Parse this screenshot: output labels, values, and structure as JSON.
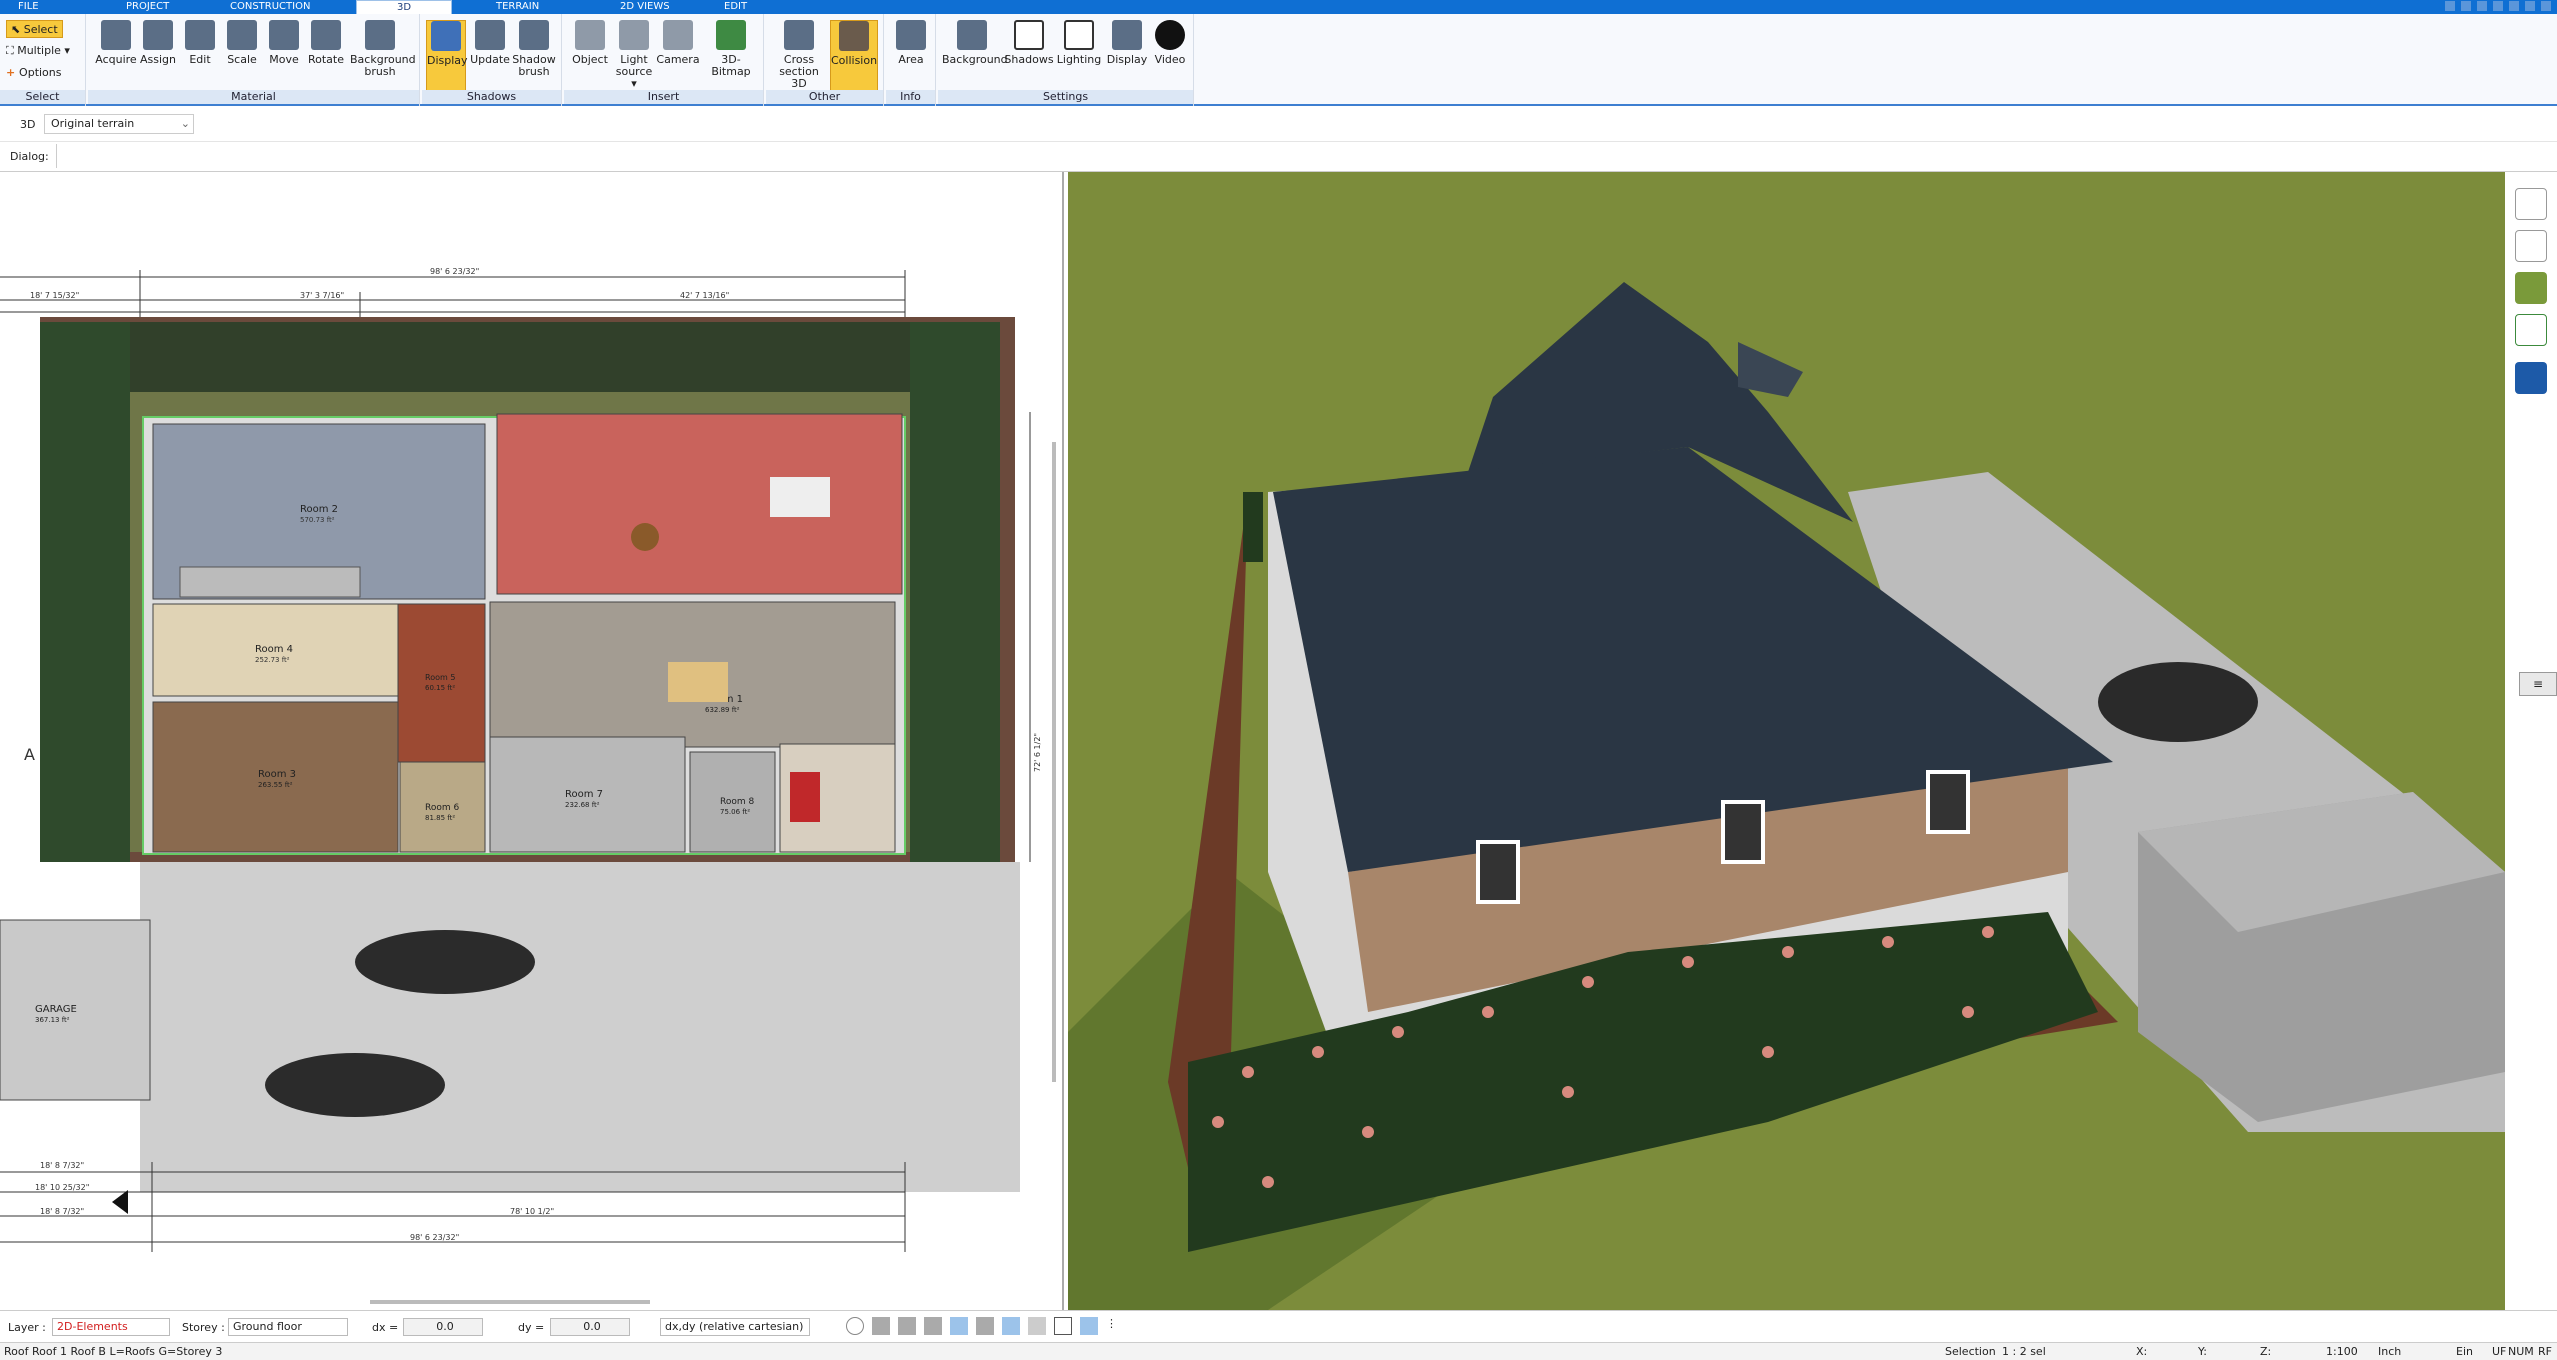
{
  "menu": {
    "tabs": [
      "FILE",
      "PROJECT",
      "CONSTRUCTION",
      "3D",
      "TERRAIN",
      "2D VIEWS",
      "EDIT"
    ]
  },
  "ribbon": {
    "select_group": {
      "select": "Select",
      "multiple": "Multiple",
      "options": "Options",
      "label": "Select"
    },
    "material": {
      "acquire": "Acquire",
      "assign": "Assign",
      "edit": "Edit",
      "scale": "Scale",
      "move": "Move",
      "rotate": "Rotate",
      "background_brush_1": "Background",
      "background_brush_2": "brush",
      "label": "Material"
    },
    "shadows": {
      "display": "Display",
      "update": "Update",
      "shadow_brush_1": "Shadow",
      "shadow_brush_2": "brush",
      "label": "Shadows"
    },
    "insert": {
      "object": "Object",
      "light_source_1": "Light",
      "light_source_2": "source",
      "camera": "Camera",
      "bitmap": "3D-Bitmap",
      "label": "Insert"
    },
    "other": {
      "cross_section_1": "Cross",
      "cross_section_2": "section 3D",
      "collision": "Collision",
      "label": "Other"
    },
    "info": {
      "area": "Area",
      "label": "Info"
    },
    "settings": {
      "background": "Background",
      "shadows": "Shadows",
      "lighting": "Lighting",
      "display": "Display",
      "video": "Video",
      "label": "Settings"
    }
  },
  "selection_row": {
    "mode": "3D",
    "terrain": "Original terrain"
  },
  "dialog_row": {
    "label": "Dialog:"
  },
  "plan": {
    "rooms": [
      {
        "name": "Room 2",
        "area": "570.73 ft²"
      },
      {
        "name": "Room 4",
        "area": "252.73 ft²"
      },
      {
        "name": "Room 3",
        "area": "263.55 ft²"
      },
      {
        "name": "Room 1",
        "area": "632.89 ft²"
      },
      {
        "name": "Room 6",
        "area": "81.85 ft²"
      },
      {
        "name": "Room 7",
        "area": "232.68 ft²"
      },
      {
        "name": "Room 8",
        "area": "75.06 ft²"
      },
      {
        "name": "Room 5",
        "area": "60.15 ft²"
      }
    ],
    "garage": {
      "name": "GARAGE",
      "area": "367.13 ft²"
    },
    "dims_top": [
      "98' 6 23/32\"",
      "18' 7 15/32\"",
      "37' 3 7/16\"",
      "42' 7 13/16\""
    ],
    "dims_bottom": [
      "18' 8 7/32\"",
      "18' 10 25/32\"",
      "18' 8 7/32\"",
      "78' 10 1/2\"",
      "98' 6 23/32\""
    ],
    "dims_right": [
      "72' 6 1/2\""
    ],
    "section_marker": "A"
  },
  "status": {
    "layer_label": "Layer :",
    "layer_value": "2D-Elements",
    "storey_label": "Storey :",
    "storey_value": "Ground floor",
    "dx_label": "dx =",
    "dx_value": "0.0",
    "dy_label": "dy =",
    "dy_value": "0.0",
    "coord_mode": "dx,dy (relative cartesian)"
  },
  "bottom": {
    "info": "Roof Roof 1 Roof B L=Roofs G=Storey 3",
    "selection": "Selection",
    "selection_count": "1 : 2 sel",
    "x": "X:",
    "y": "Y:",
    "z": "Z:",
    "scale": "1:100",
    "unit": "Inch",
    "ein": "Ein",
    "uf": "UF",
    "num": "NUM",
    "rf": "RF"
  },
  "colors": {
    "accent": "#0f6fd3",
    "ribbon_active": "#f7c93c",
    "layer_value": "#d21e1e",
    "grass": "#7c8c3b",
    "roof": "#2a3644"
  }
}
